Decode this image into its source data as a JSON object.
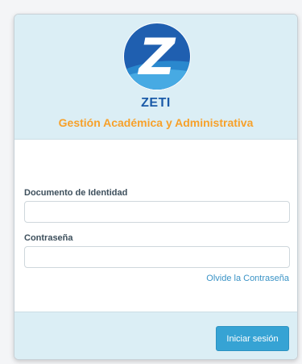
{
  "header": {
    "logo_letter": "Z",
    "brand_name": "ZETI",
    "subtitle": "Gestión Académica y Administrativa"
  },
  "form": {
    "id_label": "Documento de Identidad",
    "id_value": "",
    "password_label": "Contraseña",
    "password_value": "",
    "forgot_link": "Olvide la Contraseña"
  },
  "footer": {
    "login_button": "Iniciar sesión"
  },
  "colors": {
    "header_bg": "#dbeef5",
    "brand": "#1a5aa8",
    "subtitle": "#f7a12a",
    "link": "#3a93c6",
    "button": "#36a3d4"
  },
  "icons": {
    "logo": "zeti-logo-icon"
  }
}
